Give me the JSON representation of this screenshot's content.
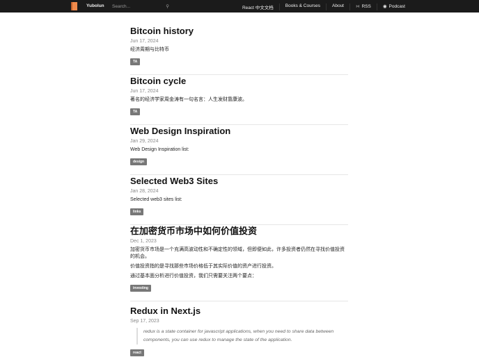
{
  "nav": {
    "brand": "Yubolun",
    "search_placeholder": "Search...",
    "links": [
      "React 中文文档",
      "Books & Courses",
      "About",
      "RSS",
      "Podcast"
    ]
  },
  "posts": [
    {
      "title": "Bitcoin history",
      "date": "Jun 17, 2024",
      "paragraphs": [
        "经济周期与比特币"
      ],
      "tag": "TA"
    },
    {
      "title": "Bitcoin cycle",
      "date": "Jun 17, 2024",
      "paragraphs": [
        "著名的经济学家周金涛有一句名言：人生发财靠康波。"
      ],
      "tag": "TA"
    },
    {
      "title": "Web Design Inspiration",
      "date": "Jan 29, 2024",
      "paragraphs": [
        "Web Design Inspiration list:"
      ],
      "tag": "design"
    },
    {
      "title": "Selected Web3 Sites",
      "date": "Jan 28, 2024",
      "paragraphs": [
        "Selected web3 sites list:"
      ],
      "tag": "links"
    },
    {
      "title": "在加密货币市场中如何价值投资",
      "date": "Dec 1, 2023",
      "paragraphs": [
        "加密货币市场是一个充满高波动性和不确定性的领域，但即便如此，许多投资者仍然在寻找价值投资的机会。",
        "价值投资指的是寻找那些市场价格低于其实际价值的资产进行投资。",
        "通过基本面分析进行价值投资，我们只需要关注两个要点："
      ],
      "tag": "investing"
    },
    {
      "title": "Redux in Next.js",
      "date": "Sep 17, 2023",
      "quote": "redux is a state container for javascript applications, when you need to share data between components, you can use redux to manage the state of the application.",
      "tag": "react"
    }
  ]
}
